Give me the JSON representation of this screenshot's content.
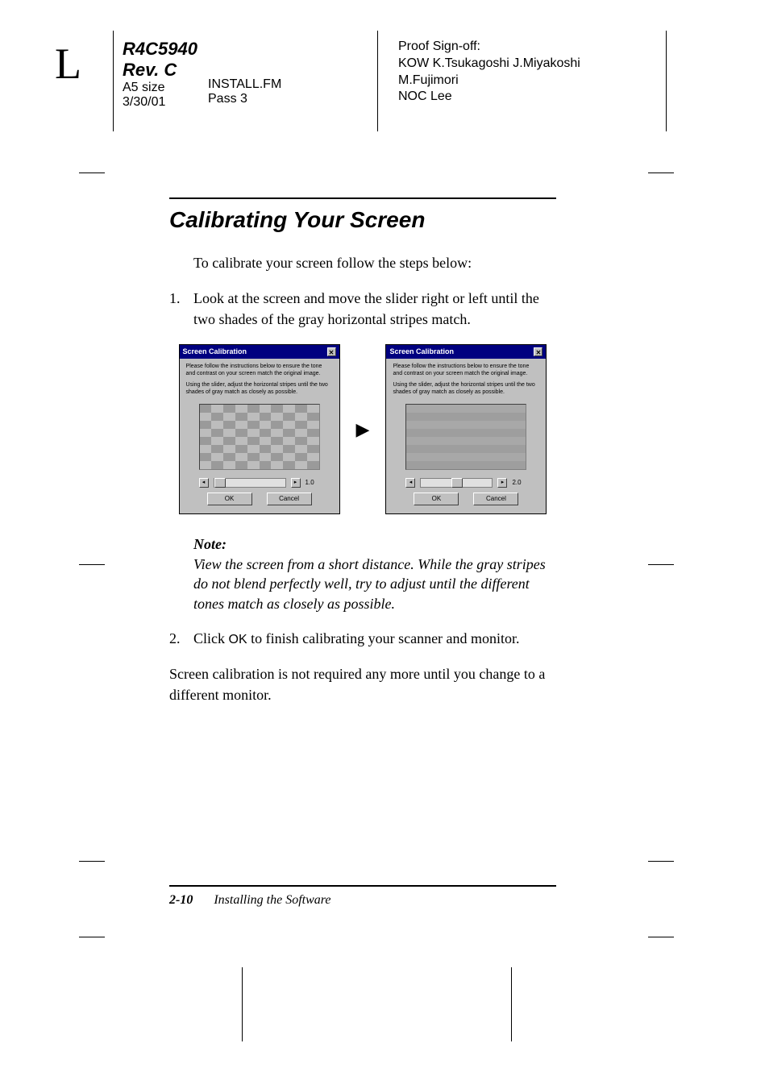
{
  "header": {
    "side_letter": "L",
    "doc_code": "R4C5940",
    "revision": "Rev. C",
    "size": "A5 size",
    "date": "3/30/01",
    "file": "INSTALL.FM",
    "pass": "Pass 3",
    "proof_label": "Proof Sign-off:",
    "proof_line1": "KOW K.Tsukagoshi  J.Miyakoshi",
    "proof_line2": "M.Fujimori",
    "proof_line3": "NOC Lee"
  },
  "section": {
    "title": "Calibrating Your Screen",
    "intro": "To calibrate your screen follow the steps below:",
    "step1_num": "1.",
    "step1_text": "Look at the screen and move the slider right or left until the two shades of the gray horizontal stripes match.",
    "step2_num": "2.",
    "step2_text_a": "Click ",
    "step2_ok": "OK",
    "step2_text_b": " to finish calibrating your scanner and monitor.",
    "closing": "Screen calibration is not required any more until you change to a different monitor."
  },
  "dialog": {
    "title": "Screen Calibration",
    "instr1": "Please follow the instructions below to ensure the tone and contrast on your screen match the original image.",
    "instr2": "Using the slider, adjust the horizontal stripes until the two shades of gray match as closely as possible.",
    "val_before": "1.0",
    "val_after": "2.0",
    "ok": "OK",
    "cancel": "Cancel"
  },
  "note": {
    "label": "Note:",
    "body": "View the screen from a short distance. While the gray stripes do not blend perfectly well, try to adjust until the different tones match as closely as possible."
  },
  "footer": {
    "page": "2-10",
    "chapter": "Installing the Software"
  }
}
